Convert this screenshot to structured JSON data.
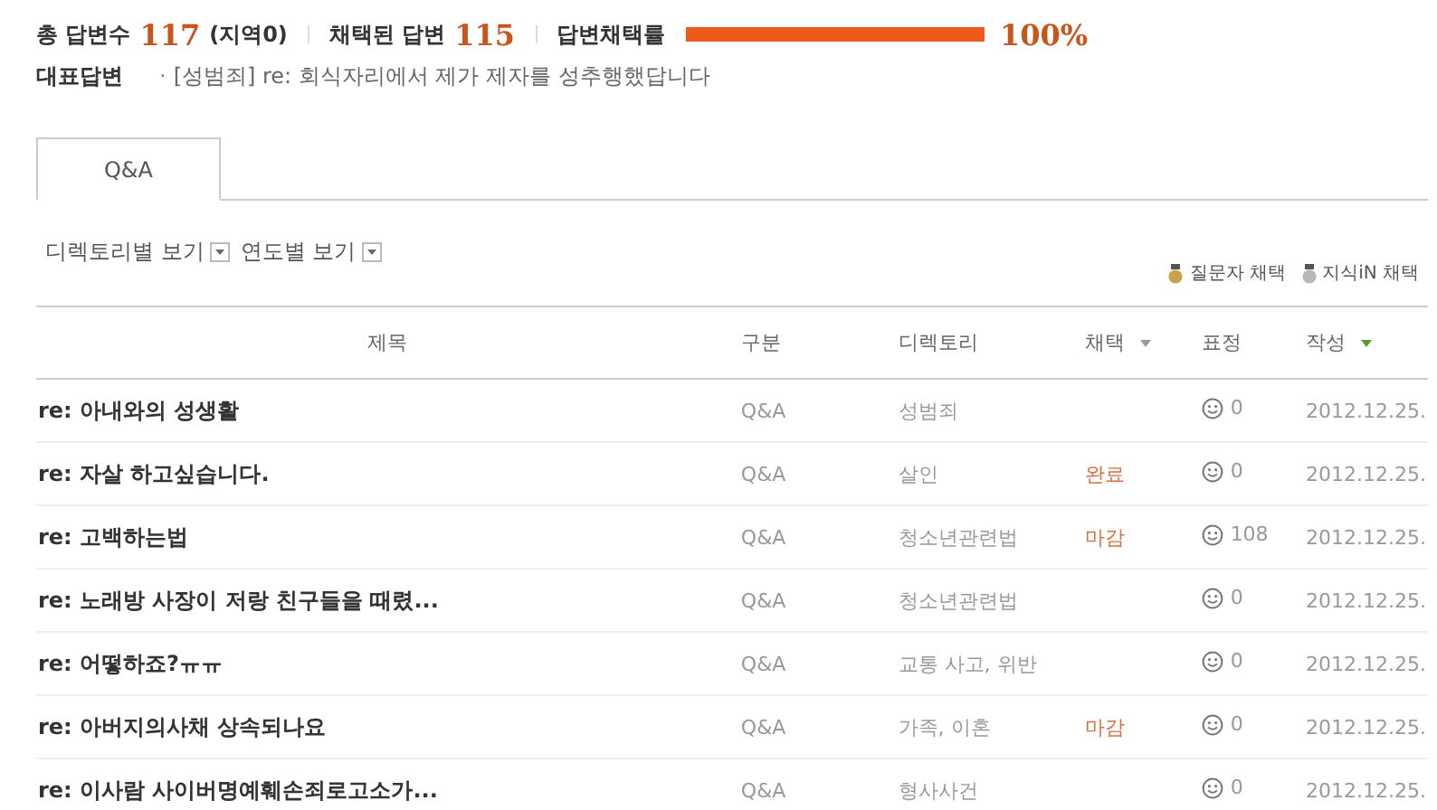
{
  "stats": {
    "total_label": "총 답변수",
    "total": "117",
    "region": "(지역0)",
    "chosen_label": "채택된 답변",
    "chosen": "115",
    "rate_label": "답변채택률",
    "rate": {
      "level": 1.0,
      "reading": "100%"
    }
  },
  "featured": {
    "label": "대표답변",
    "bullet": "·",
    "text": "[성범죄] re: 회식자리에서 제가 제자를 성추행했답니다"
  },
  "tabs": [
    {
      "label": "Q&A",
      "selected": true
    }
  ],
  "filters": [
    {
      "label": "디렉토리별 보기"
    },
    {
      "label": "연도별 보기"
    }
  ],
  "legend": [
    {
      "label": "질문자 채택",
      "color": "#c9a24a"
    },
    {
      "label": "지식iN 채택",
      "color": "#b8b8b8"
    }
  ],
  "table": {
    "columns": [
      {
        "label": "제목",
        "sortable": false
      },
      {
        "label": "구분",
        "sortable": false
      },
      {
        "label": "디렉토리",
        "sortable": false
      },
      {
        "label": "채택",
        "sortable": true,
        "sorted": false
      },
      {
        "label": "표정",
        "sortable": false
      },
      {
        "label": "작성",
        "sortable": true,
        "sorted": true
      }
    ],
    "rows": [
      {
        "title": "re: 아내와의 성생활",
        "type": "Q&A",
        "directory": "성범죄",
        "status": "",
        "reactions": "0",
        "date": "2012.12.25."
      },
      {
        "title": "re: 자살 하고싶습니다.",
        "type": "Q&A",
        "directory": "살인",
        "status": "완료",
        "reactions": "0",
        "date": "2012.12.25."
      },
      {
        "title": "re: 고백하는법",
        "type": "Q&A",
        "directory": "청소년관련법",
        "status": "마감",
        "reactions": "108",
        "date": "2012.12.25."
      },
      {
        "title": "re: 노래방 사장이 저랑 친구들을 때렸...",
        "type": "Q&A",
        "directory": "청소년관련법",
        "status": "",
        "reactions": "0",
        "date": "2012.12.25."
      },
      {
        "title": "re: 어떻하죠?ㅠㅠ",
        "type": "Q&A",
        "directory": "교통 사고, 위반",
        "status": "",
        "reactions": "0",
        "date": "2012.12.25."
      },
      {
        "title": "re: 아버지의사채 상속되나요",
        "type": "Q&A",
        "directory": "가족, 이혼",
        "status": "마감",
        "reactions": "0",
        "date": "2012.12.25."
      },
      {
        "title": "re: 이사람 사이버명예훼손죄로고소가...",
        "type": "Q&A",
        "directory": "형사사건",
        "status": "",
        "reactions": "0",
        "date": "2012.12.25."
      }
    ]
  }
}
